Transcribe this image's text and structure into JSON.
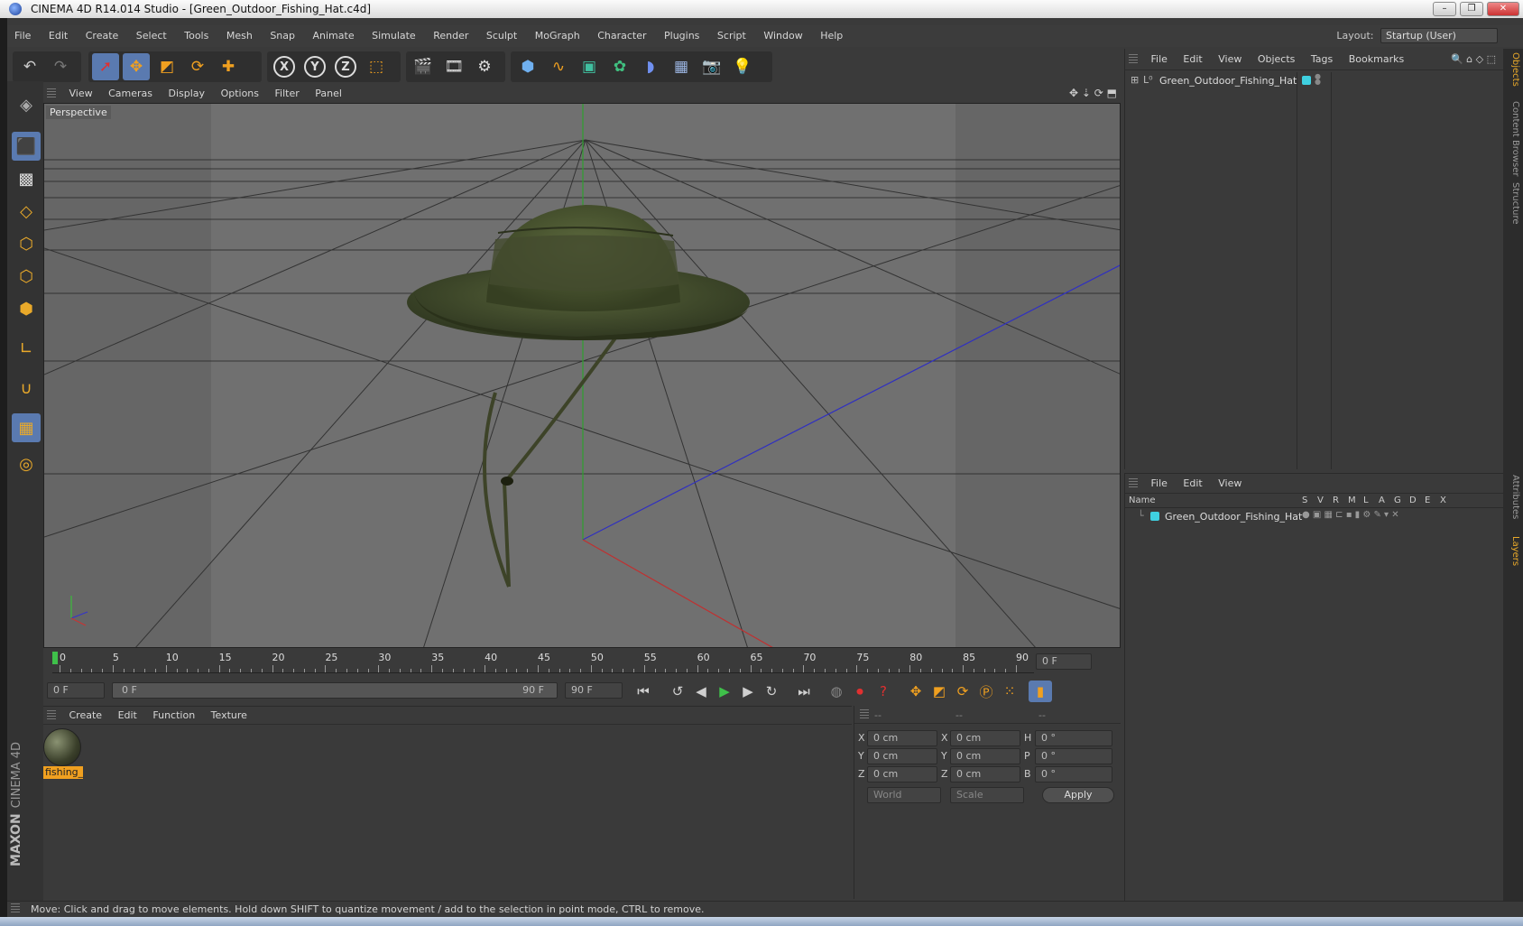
{
  "window": {
    "title": "CINEMA 4D R14.014 Studio - [Green_Outdoor_Fishing_Hat.c4d]"
  },
  "menubar": {
    "items": [
      "File",
      "Edit",
      "Create",
      "Select",
      "Tools",
      "Mesh",
      "Snap",
      "Animate",
      "Simulate",
      "Render",
      "Sculpt",
      "MoGraph",
      "Character",
      "Plugins",
      "Script",
      "Window",
      "Help"
    ],
    "layout_label": "Layout:",
    "layout_value": "Startup (User)"
  },
  "viewport": {
    "menu": [
      "View",
      "Cameras",
      "Display",
      "Options",
      "Filter",
      "Panel"
    ],
    "label": "Perspective"
  },
  "timeline": {
    "ticks": [
      "0",
      "5",
      "10",
      "15",
      "20",
      "25",
      "30",
      "35",
      "40",
      "45",
      "50",
      "55",
      "60",
      "65",
      "70",
      "75",
      "80",
      "85",
      "90"
    ],
    "current_frame": "0 F"
  },
  "transport": {
    "start": "0 F",
    "range_start": "0 F",
    "range_end": "90 F",
    "end": "90 F"
  },
  "materials": {
    "menu": [
      "Create",
      "Edit",
      "Function",
      "Texture"
    ],
    "items": [
      {
        "name": "fishing_"
      }
    ]
  },
  "coords": {
    "headers": [
      "--",
      "--",
      "--"
    ],
    "rows": [
      {
        "a": "X",
        "av": "0 cm",
        "b": "X",
        "bv": "0 cm",
        "c": "H",
        "cv": "0 °"
      },
      {
        "a": "Y",
        "av": "0 cm",
        "b": "Y",
        "bv": "0 cm",
        "c": "P",
        "cv": "0 °"
      },
      {
        "a": "Z",
        "av": "0 cm",
        "b": "Z",
        "bv": "0 cm",
        "c": "B",
        "cv": "0 °"
      }
    ],
    "world": "World",
    "scale": "Scale",
    "apply": "Apply"
  },
  "objects": {
    "menu": [
      "File",
      "Edit",
      "View",
      "Objects",
      "Tags",
      "Bookmarks"
    ],
    "item": "Green_Outdoor_Fishing_Hat"
  },
  "layers": {
    "menu": [
      "File",
      "Edit",
      "View"
    ],
    "columns": [
      "Name",
      "S",
      "V",
      "R",
      "M",
      "L",
      "A",
      "G",
      "D",
      "E",
      "X"
    ],
    "item": "Green_Outdoor_Fishing_Hat"
  },
  "right_tabs": [
    "Objects",
    "Content Browser",
    "Structure",
    "Attributes",
    "Layers"
  ],
  "status": "Move: Click and drag to move elements. Hold down SHIFT to quantize movement / add to the selection in point mode, CTRL to remove.",
  "brand": {
    "line1": "MAXON",
    "line2": "CINEMA 4D"
  },
  "colors": {
    "accent": "#5a7ab0",
    "tool_orange": "#f0a020",
    "layer_cyan": "#3fd0e0",
    "axis_x": "#c03030",
    "axis_y": "#30b030",
    "axis_z": "#3030c0"
  }
}
